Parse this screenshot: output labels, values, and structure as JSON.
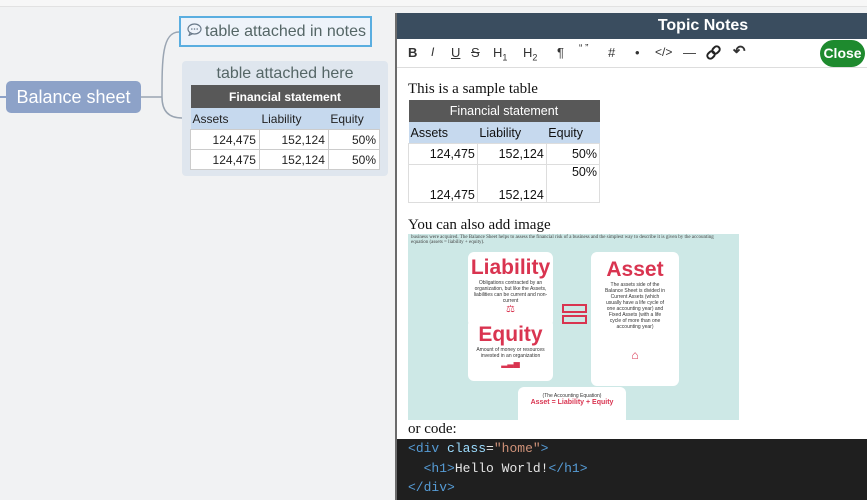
{
  "mindmap": {
    "root_label": "Balance sheet",
    "note_node_label": "table attached in notes",
    "table_node_title": "table attached here",
    "table": {
      "header": "Financial statement",
      "columns": [
        "Assets",
        "Liability",
        "Equity"
      ],
      "rows": [
        [
          "124,475",
          "152,124",
          "50%"
        ],
        [
          "124,475",
          "152,124",
          "50%"
        ]
      ]
    }
  },
  "panel": {
    "title": "Topic Notes",
    "toolbar": [
      "B",
      "I",
      "U",
      "S",
      "H1",
      "H2",
      "¶",
      "“ ”",
      "#",
      "•",
      "</>",
      "—",
      "link",
      "undo"
    ],
    "close_label": "Close",
    "sample_text": "This is a sample table",
    "table": {
      "header": "Financial statement",
      "columns": [
        "Assets",
        "Liability",
        "Equity"
      ],
      "rows": [
        [
          "124,475",
          "152,124",
          "50%"
        ],
        [
          "124,475",
          "152,124",
          "50%"
        ]
      ]
    },
    "image_caption": "You can also add image",
    "image": {
      "top_text": "business were acquired. The Balance Sheet helps to assess the financial risk of a business and the simplest way to describe it is given by the accounting equation (assets = liability + equity).",
      "liability": "Liability",
      "liability_desc": "Obligations contracted by an organization, but like the Assets, liabilities can be current and non-current",
      "equity": "Equity",
      "equity_desc": "Amount of money or resources invested in an organization",
      "asset": "Asset",
      "asset_desc": "The assets side of the Balance Sheet is divided in Current Assets (which usually have a life cycle of one accounting year) and Fixed Assets (with a life cycle of more than one accounting year)",
      "formula_title": "(The Accounting Equation)",
      "formula": "Asset = Liability + Equity"
    },
    "code_caption": "or code:",
    "code": {
      "line1_tag": "div",
      "line1_attr": "class",
      "line1_val": "\"home\"",
      "line2_tag": "h1",
      "line2_text": "Hello World!",
      "line3_tag": "div"
    }
  },
  "colors": {
    "root": "#8da2c8",
    "panel_header": "#3a4d5f",
    "close": "#1e8a2e",
    "accent_red": "#d93450"
  }
}
